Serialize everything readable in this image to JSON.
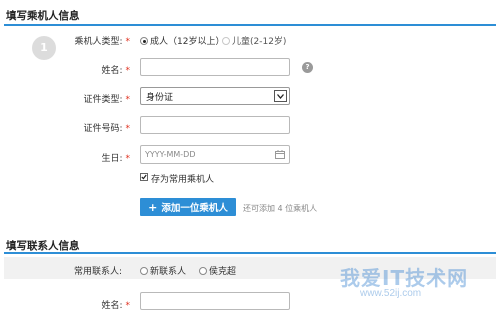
{
  "passenger_section": {
    "title": "填写乘机人信息",
    "step": "1",
    "type_label": "乘机人类型:",
    "type_options": [
      "成人（12岁以上）",
      "儿童(2-12岁)"
    ],
    "name_label": "姓名:",
    "id_type_label": "证件类型:",
    "id_type_value": "身份证",
    "id_number_label": "证件号码:",
    "birthday_label": "生日:",
    "birthday_placeholder": "YYYY-MM-DD",
    "save_checkbox_label": "存为常用乘机人",
    "add_button": "添加一位乘机人",
    "add_hint": "还可添加 4 位乘机人"
  },
  "contact_section": {
    "title": "填写联系人信息",
    "contact_label": "常用联系人:",
    "contact_options": [
      "新联系人",
      "侯克超"
    ],
    "name_label": "姓名:"
  },
  "watermark": {
    "text": "我爱IT技术网",
    "url": "www.52ij.com"
  },
  "colors": {
    "accent": "#2d8ed6",
    "required": "#e0301e"
  }
}
